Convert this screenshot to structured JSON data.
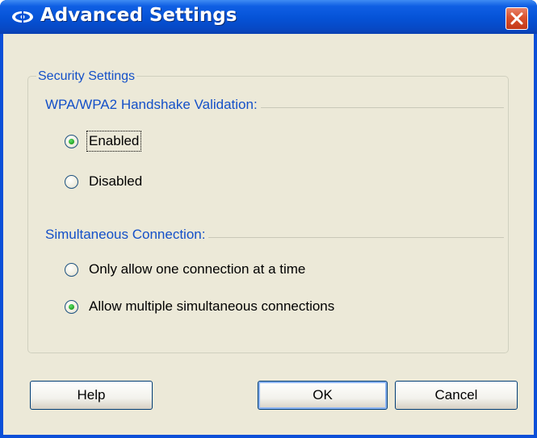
{
  "window": {
    "title": "Advanced Settings",
    "title_icon": "wireless-icon",
    "close_icon": "close-icon",
    "titlebar_color": "#0552d6",
    "close_color": "#d9512c"
  },
  "security_group": {
    "title": "Security Settings",
    "handshake": {
      "title": "WPA/WPA2 Handshake Validation:",
      "options": [
        {
          "label": "Enabled",
          "selected": true
        },
        {
          "label": "Disabled",
          "selected": false
        }
      ]
    },
    "simultaneous": {
      "title": "Simultaneous Connection:",
      "options": [
        {
          "label": "Only allow one connection at a time",
          "selected": false
        },
        {
          "label": "Allow multiple simultaneous connections",
          "selected": true
        }
      ]
    }
  },
  "buttons": {
    "help": "Help",
    "ok": "OK",
    "cancel": "Cancel"
  },
  "colors": {
    "group_text": "#1450c8",
    "dialog_bg": "#ece9d8",
    "radio_dot": "#21a121"
  }
}
